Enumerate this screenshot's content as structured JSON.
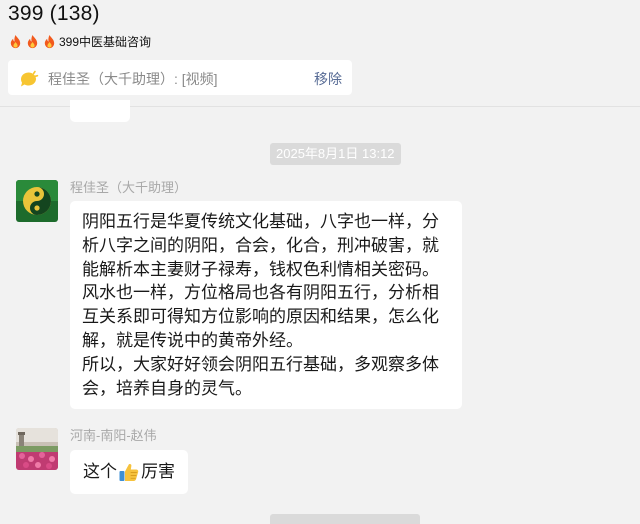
{
  "header": {
    "title": "399 (138)",
    "notice": {
      "icons": [
        "fire-icon",
        "fire-icon",
        "fire-icon"
      ],
      "text": "399中医基础咨询"
    }
  },
  "pinned": {
    "icon": "pinned-message-icon",
    "text": "程佳圣（大千助理）: [视频]",
    "remove_label": "移除"
  },
  "timestamp": "2025年8月1日 13:12",
  "messages": [
    {
      "sender": "程佳圣（大千助理）",
      "avatar": "yin-yang-avatar",
      "paragraphs": [
        "阴阳五行是华夏传统文化基础，八字也一样，分析八字之间的阴阳，合会，化合，刑冲破害，就能解析本主妻财子禄寿，钱权色利情相关密码。",
        "风水也一样，方位格局也各有阴阳五行，分析相互关系即可得知方位影响的原因和结果，怎么化解，就是传说中的黄帝外经。",
        "所以，大家好好领会阴阳五行基础，多观察多体会，培养自身的灵气。"
      ]
    },
    {
      "sender": "河南-南阳-赵伟",
      "avatar": "flower-photo-avatar",
      "text_before": "这个",
      "emoji": "thumbs-up-emoji",
      "text_after": "厉害"
    }
  ],
  "colors": {
    "background": "#f2f2f2",
    "bubble": "#ffffff",
    "link": "#576b95",
    "name": "#a8a8a8"
  }
}
